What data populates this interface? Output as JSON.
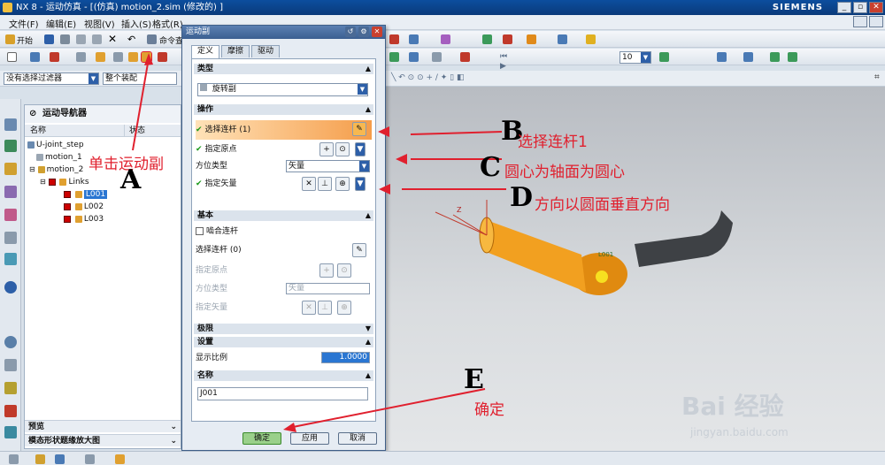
{
  "window": {
    "title": "NX 8 - 运动仿真 - [(仿真) motion_2.sim  (修改的) ]",
    "brand": "SIEMENS",
    "controls": [
      "_",
      "▫",
      "✕"
    ]
  },
  "menubar": {
    "items": [
      "文件(F)",
      "编辑(E)",
      "视图(V)",
      "插入(S)",
      "格式(R)"
    ]
  },
  "toolbar1": {
    "start_label": "开始",
    "command_label": "命令查"
  },
  "filterbar": {
    "filter_value": "没有选择过滤器",
    "assembly_value": "整个装配"
  },
  "navigator": {
    "title": "运动导航器",
    "columns": [
      "名称",
      "状态"
    ],
    "tree": [
      {
        "label": "U-joint_step",
        "level": 0
      },
      {
        "label": "motion_1",
        "level": 1
      },
      {
        "label": "motion_2",
        "level": 1
      },
      {
        "label": "Links",
        "level": 2
      },
      {
        "label": "L001",
        "level": 3,
        "selected": true
      },
      {
        "label": "L002",
        "level": 3
      },
      {
        "label": "L003",
        "level": 3
      }
    ],
    "bottom_panels": [
      "预览",
      "模态形状题缘放大图"
    ]
  },
  "dialog": {
    "title": "运动副",
    "tabs": [
      "定义",
      "摩擦",
      "驱动"
    ],
    "type_section": "类型",
    "type_value": "旋转副",
    "operation_section": "操作",
    "select_link": "选择连杆 (1)",
    "specify_origin": "指定原点",
    "orientation_type_label": "方位类型",
    "orientation_type_value": "矢量",
    "specify_vector": "指定矢量",
    "base_section": "基本",
    "snap_link": "啮合连杆",
    "base_select_link": "选择连杆 (0)",
    "base_specify_origin": "指定原点",
    "base_orientation_label": "方位类型",
    "base_orientation_value": "矢量",
    "base_specify_vector": "指定矢量",
    "limits_section": "极限",
    "settings_section": "设置",
    "display_scale_label": "显示比例",
    "display_scale_value": "1.0000",
    "name_section": "名称",
    "name_value": "J001",
    "ok_label": "确定",
    "apply_label": "应用",
    "cancel_label": "取消"
  },
  "annotations": {
    "a_text": "单击运动副",
    "a_letter": "A",
    "b_letter": "B",
    "b_text": "选择连杆1",
    "c_letter": "C",
    "c_text": "圆心为轴面为圆心",
    "d_letter": "D",
    "d_text": "方向以圆面垂直方向",
    "e_letter": "E",
    "e_text": "确定",
    "color": "#e0202e"
  },
  "viewport": {
    "link_label": "L001",
    "axis_z": "Z"
  },
  "zoom_combo": "10",
  "watermark": {
    "main": "Bai 经验",
    "sub": "jingyan.baidu.com"
  }
}
